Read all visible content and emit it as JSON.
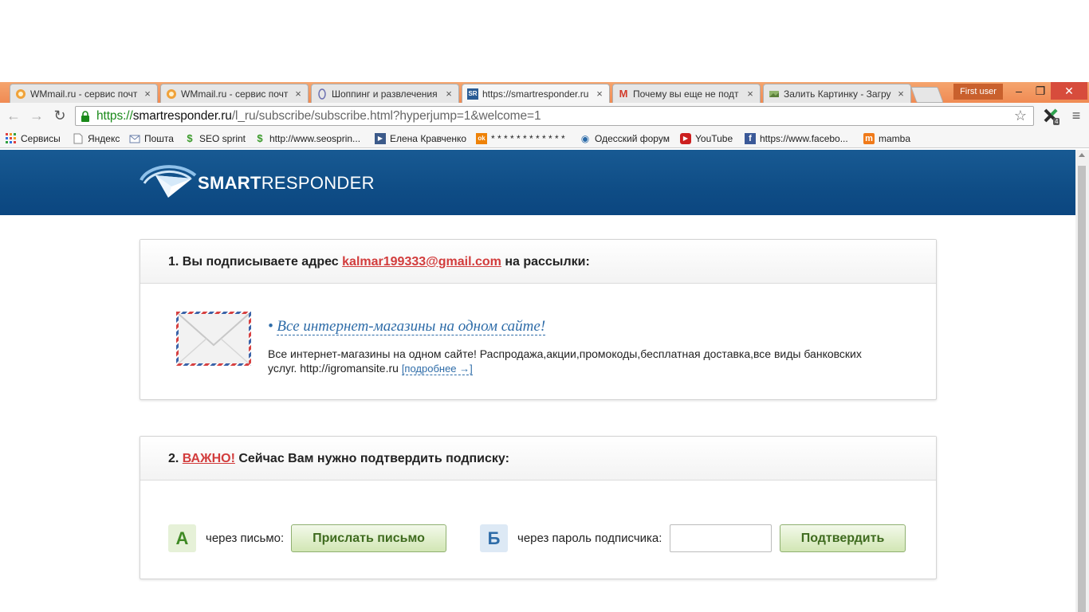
{
  "tabs": [
    {
      "title": "WMmail.ru - сервис почт",
      "icon": "wmmail-icon"
    },
    {
      "title": "WMmail.ru - сервис почт",
      "icon": "wmmail-icon"
    },
    {
      "title": "Шоппинг и развлечения",
      "icon": "site-icon"
    },
    {
      "title": "https://smartresponder.ru",
      "icon": "smartresponder-icon",
      "favicon_text": "SR",
      "active": true
    },
    {
      "title": "Почему вы еще не подт",
      "icon": "gmail-icon",
      "favicon_text": "M"
    },
    {
      "title": "Залить Картинку - Загру",
      "icon": "image-upload-icon"
    }
  ],
  "window": {
    "user_label": "First user",
    "minimize": "–",
    "restore": "❐",
    "close": "✕"
  },
  "toolbar": {
    "back": "←",
    "forward": "→",
    "reload": "↻",
    "url_scheme": "https://",
    "url_host": "smartresponder.ru",
    "url_path": "/l_ru/subscribe/subscribe.html?hyperjump=1&welcome=1",
    "extension_badge": "4",
    "menu": "≡",
    "star": "☆"
  },
  "bookmarks": [
    {
      "label": "Сервисы",
      "icon": "apps-grid-icon"
    },
    {
      "label": "Яндекс",
      "icon": "page-icon"
    },
    {
      "label": "Пошта",
      "icon": "mail-icon"
    },
    {
      "label": "SEO sprint",
      "icon": "seosprint-icon",
      "glyph": "$"
    },
    {
      "label": "http://www.seosprin...",
      "icon": "seosprint-icon",
      "glyph": "$"
    },
    {
      "label": "Елена Кравченко",
      "icon": "play-icon",
      "glyph": "▶"
    },
    {
      "label": "* * * * * * * * * * * *",
      "icon": "odnoklassniki-icon",
      "glyph": "ok"
    },
    {
      "label": "Одесский форум",
      "icon": "eye-icon",
      "glyph": "◉"
    },
    {
      "label": "YouTube",
      "icon": "youtube-icon",
      "glyph": "▶"
    },
    {
      "label": "https://www.facebo...",
      "icon": "facebook-icon",
      "glyph": "f"
    },
    {
      "label": "mamba",
      "icon": "mamba-icon",
      "glyph": "m"
    }
  ],
  "site": {
    "logo_bold": "SMART",
    "logo_light": "RESPONDER"
  },
  "section1": {
    "prefix": "1. Вы подписываете адрес ",
    "email": "kalmar199333@gmail.com",
    "suffix": " на рассылки:",
    "newsletter_bullet": "•",
    "newsletter_title": "Все интернет-магазины на одном сайте!",
    "newsletter_desc": "Все интернет-магазины на одном сайте! Распродажа,акции,промокоды,бесплатная доставка,все виды банковских услуг. http://igromansite.ru ",
    "more_link": "[подробнее →]"
  },
  "section2": {
    "prefix": "2. ",
    "important": "ВАЖНО!",
    "suffix": " Сейчас Вам нужно подтвердить подписку:",
    "option_a_letter": "А",
    "option_a_label": "через письмо:",
    "send_button": "Прислать письмо",
    "option_b_letter": "Б",
    "option_b_label": "через пароль подписчика:",
    "password_value": "",
    "confirm_button": "Подтвердить"
  }
}
